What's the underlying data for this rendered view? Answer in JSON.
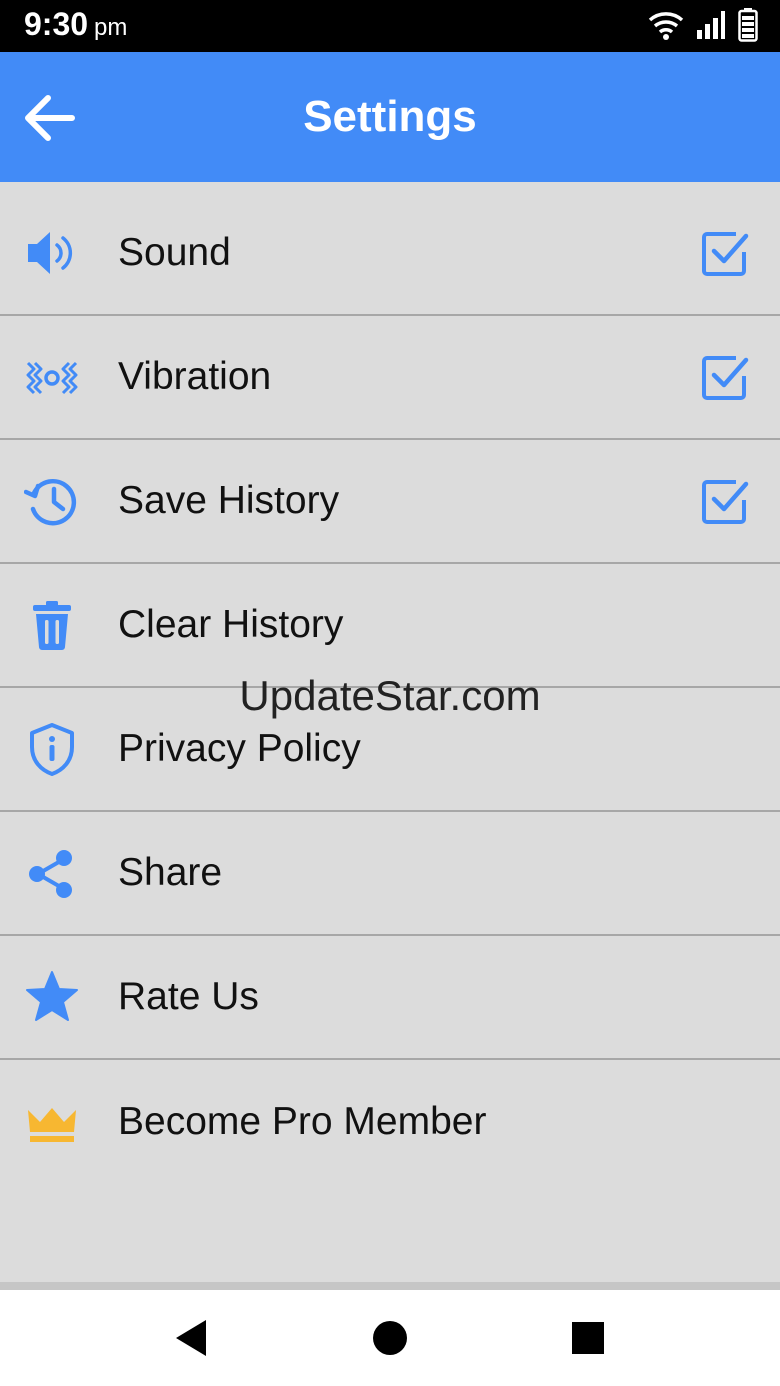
{
  "status_bar": {
    "time": "9:30",
    "ampm": "pm",
    "icons": [
      "wifi-icon",
      "signal-icon",
      "battery-icon"
    ]
  },
  "app_bar": {
    "title": "Settings",
    "back_icon": "arrow-left-icon"
  },
  "colors": {
    "accent": "#428bf7",
    "background": "#dcdcdc",
    "crown": "#f7b731"
  },
  "settings": [
    {
      "label": "Sound",
      "icon": "speaker-icon",
      "checked": true
    },
    {
      "label": "Vibration",
      "icon": "vibration-icon",
      "checked": true
    },
    {
      "label": "Save History",
      "icon": "history-icon",
      "checked": true
    },
    {
      "label": "Clear History",
      "icon": "trash-icon"
    },
    {
      "label": "Privacy Policy",
      "icon": "shield-info-icon"
    },
    {
      "label": "Share",
      "icon": "share-icon"
    },
    {
      "label": "Rate Us",
      "icon": "star-icon"
    },
    {
      "label": "Become Pro Member",
      "icon": "crown-icon"
    }
  ],
  "watermark": "UpdateStar.com",
  "nav_bar": {
    "buttons": [
      "back-triangle-icon",
      "home-circle-icon",
      "recents-square-icon"
    ]
  }
}
